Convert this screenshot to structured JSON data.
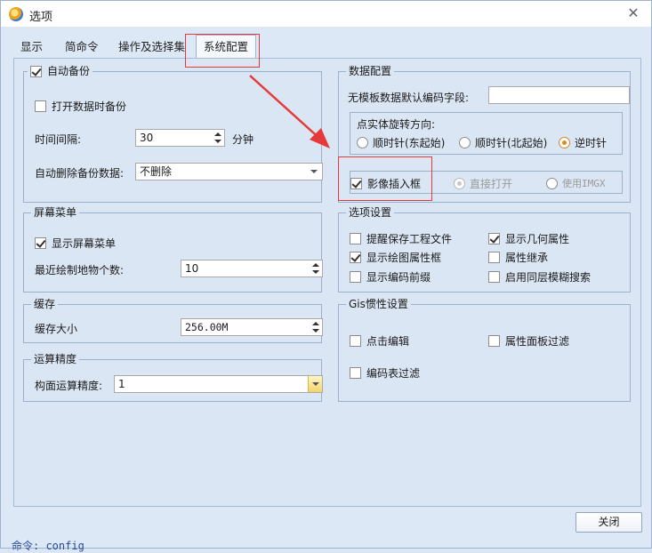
{
  "window": {
    "title": "选项",
    "close_glyph": "✕"
  },
  "tabs": [
    {
      "label": "显示",
      "active": false
    },
    {
      "label": "简命令",
      "active": false
    },
    {
      "label": "操作及选择集",
      "active": false
    },
    {
      "label": "系统配置",
      "active": true
    }
  ],
  "auto_backup": {
    "title": "自动备份",
    "title_checked": true,
    "open_backup_label": "打开数据时备份",
    "open_backup_checked": false,
    "interval_label": "时间间隔:",
    "interval_value": "30",
    "interval_unit": "分钟",
    "delete_label": "自动删除备份数据:",
    "delete_value": "不删除"
  },
  "screen_menu": {
    "title": "屏幕菜单",
    "show_label": "显示屏幕菜单",
    "show_checked": true,
    "recent_label": "最近绘制地物个数:",
    "recent_value": "10"
  },
  "cache": {
    "title": "缓存",
    "size_label": "缓存大小",
    "size_value": "256.00M"
  },
  "precision": {
    "title": "运算精度",
    "label": "构面运算精度:",
    "value": "1"
  },
  "data_config": {
    "title": "数据配置",
    "default_field_label": "无模板数据默认编码字段:",
    "default_field_value": "",
    "rotation_label": "点实体旋转方向:",
    "rotation_options": [
      {
        "label": "顺时针(东起始)",
        "selected": false
      },
      {
        "label": "顺时针(北起始)",
        "selected": false
      },
      {
        "label": "逆时针",
        "selected": true
      }
    ],
    "image_insert_label": "影像插入框",
    "image_insert_checked": true,
    "open_direct_label": "直接打开",
    "open_direct_selected": true,
    "use_imgx_label": "使用IMGX",
    "use_imgx_selected": false
  },
  "options": {
    "title": "选项设置",
    "items": [
      {
        "label": "提醒保存工程文件",
        "checked": false
      },
      {
        "label": "显示几何属性",
        "checked": true
      },
      {
        "label": "显示绘图属性框",
        "checked": true
      },
      {
        "label": "属性继承",
        "checked": false
      },
      {
        "label": "显示编码前缀",
        "checked": false
      },
      {
        "label": "启用同层模糊搜索",
        "checked": false
      }
    ]
  },
  "gis": {
    "title": "Gis惯性设置",
    "items": [
      {
        "label": "点击编辑",
        "checked": false
      },
      {
        "label": "属性面板过滤",
        "checked": false
      },
      {
        "label": "编码表过滤",
        "checked": false
      }
    ]
  },
  "footer": {
    "close_label": "关闭",
    "console_text": "命令: config"
  },
  "colors": {
    "annotation_red": "#e63a3a",
    "window_bg": "#dde8f6"
  }
}
